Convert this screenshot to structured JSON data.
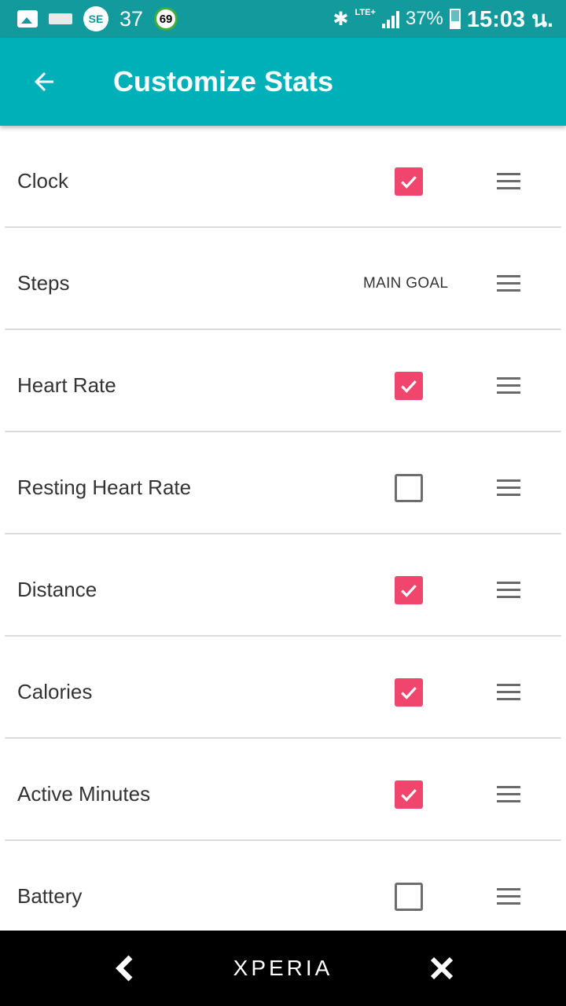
{
  "status_bar": {
    "notification_count": "37",
    "badge_number": "69",
    "network_label": "LTE+",
    "battery_percent": "37%",
    "battery_level": 0.37,
    "time": "15:03 น.",
    "icons": [
      "image-icon",
      "card-icon",
      "se-icon",
      "bluetooth-icon",
      "signal-icon",
      "battery-icon"
    ]
  },
  "app_bar": {
    "title": "Customize Stats",
    "back_icon": "arrow-left-icon",
    "background_color": "#00b0b9"
  },
  "stats": [
    {
      "label": "Clock",
      "checked": true
    },
    {
      "label": "Steps",
      "main_goal_label": "MAIN GOAL"
    },
    {
      "label": "Heart Rate",
      "checked": true
    },
    {
      "label": "Resting Heart Rate",
      "checked": false
    },
    {
      "label": "Distance",
      "checked": true
    },
    {
      "label": "Calories",
      "checked": true
    },
    {
      "label": "Active Minutes",
      "checked": true
    },
    {
      "label": "Battery",
      "checked": false
    }
  ],
  "colors": {
    "checkbox_checked": "#f0466d",
    "status_bar": "#139a9d"
  },
  "nav_bar": {
    "home_label": "XPERIA",
    "back_icon": "nav-back-icon",
    "recent_icon": "nav-recent-icon"
  }
}
